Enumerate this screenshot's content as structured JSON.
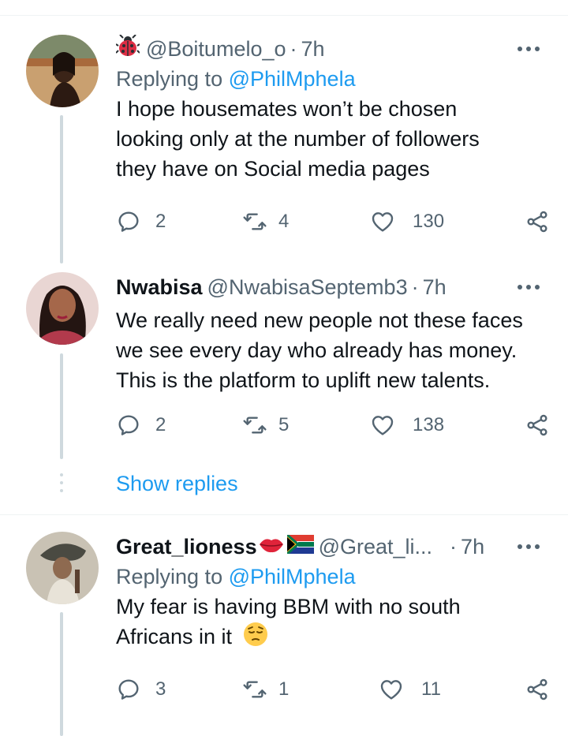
{
  "tweets": [
    {
      "name": "",
      "handle": "@Boitumelo_o",
      "time": "7h",
      "replying_prefix": "Replying to ",
      "replying_to": "@PhilMphela",
      "text": "I hope housemates won’t be chosen looking only at the number of followers they have on Social media pages",
      "replies": "2",
      "retweets": "4",
      "likes": "130"
    },
    {
      "name": "Nwabisa",
      "handle": "@NwabisaSeptemb3",
      "time": "7h",
      "text": "We really need new people not these faces we see every day who already has money. This is the platform to uplift new talents.",
      "replies": "2",
      "retweets": "5",
      "likes": "138"
    },
    {
      "name": "Great_lioness",
      "handle": "@Great_li...",
      "time": "7h",
      "replying_prefix": "Replying to ",
      "replying_to": "@PhilMphela",
      "text": "My fear is having BBM with no south Africans in it",
      "replies": "3",
      "retweets": "1",
      "likes": "11"
    }
  ],
  "show_replies": "Show replies",
  "separator": "·",
  "colors": {
    "accent": "#1d9bf0",
    "muted": "#536471",
    "text": "#0f1419"
  },
  "icons": [
    "ladybug-icon",
    "kiss-lips-icon",
    "south-africa-flag-icon",
    "pensive-face-icon",
    "reply-icon",
    "retweet-icon",
    "heart-icon",
    "share-icon",
    "more-icon"
  ]
}
